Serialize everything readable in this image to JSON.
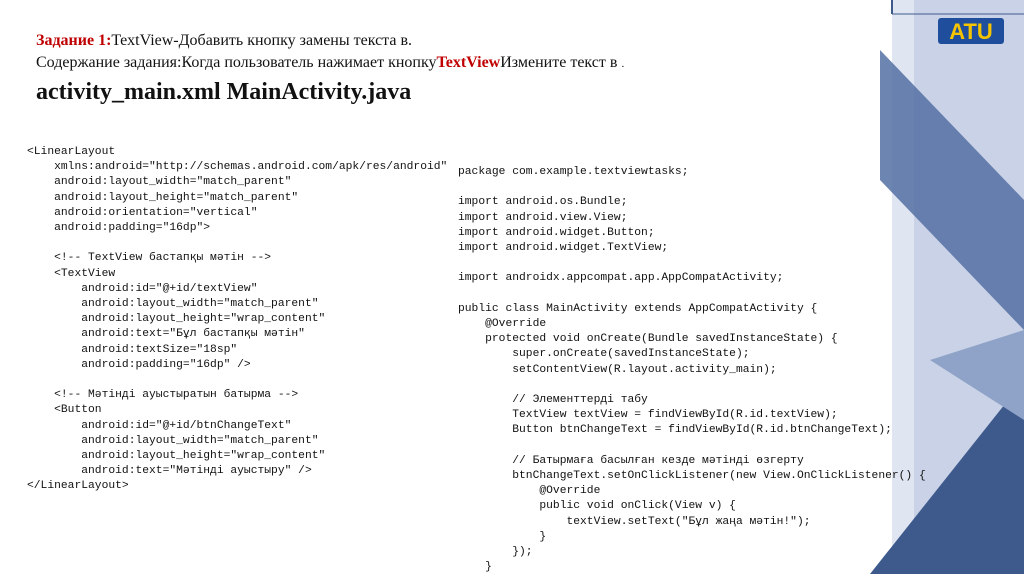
{
  "heading": {
    "task_label": "Задание 1:",
    "task_text": "TextView-Добавить кнопку замены текста в.",
    "content_label": "Содержание задания:",
    "content_text": "Когда пользователь нажимает кнопку",
    "content_highlight": "TextView",
    "content_text_end": "Измените текст в",
    "content_dot": ".",
    "files_title": "activity_main.xml MainActivity.java"
  },
  "code": {
    "xml": "<LinearLayout\n    xmlns:android=\"http://schemas.android.com/apk/res/android\"\n    android:layout_width=\"match_parent\"\n    android:layout_height=\"match_parent\"\n    android:orientation=\"vertical\"\n    android:padding=\"16dp\">\n\n    <!-- TextView бастапқы мәтін -->\n    <TextView\n        android:id=\"@+id/textView\"\n        android:layout_width=\"match_parent\"\n        android:layout_height=\"wrap_content\"\n        android:text=\"Бұл бастапқы мәтін\"\n        android:textSize=\"18sp\"\n        android:padding=\"16dp\" />\n\n    <!-- Мәтінді ауыстыратын батырма -->\n    <Button\n        android:id=\"@+id/btnChangeText\"\n        android:layout_width=\"match_parent\"\n        android:layout_height=\"wrap_content\"\n        android:text=\"Мәтінді ауыстыру\" />\n</LinearLayout>",
    "java": "package com.example.textviewtasks;\n\nimport android.os.Bundle;\nimport android.view.View;\nimport android.widget.Button;\nimport android.widget.TextView;\n\nimport androidx.appcompat.app.AppCompatActivity;\n\npublic class MainActivity extends AppCompatActivity {\n    @Override\n    protected void onCreate(Bundle savedInstanceState) {\n        super.onCreate(savedInstanceState);\n        setContentView(R.layout.activity_main);\n\n        // Элементтерді табу\n        TextView textView = findViewById(R.id.textView);\n        Button btnChangeText = findViewById(R.id.btnChangeText);\n\n        // Батырмаға басылған кезде мәтінді өзгерту\n        btnChangeText.setOnClickListener(new View.OnClickListener() {\n            @Override\n            public void onClick(View v) {\n                textView.setText(\"Бұл жаңа мәтін!\");\n            }\n        });\n    }\n}"
  },
  "logo": {
    "text": "ATU"
  },
  "colors": {
    "highlight": "#c00000",
    "logo_yellow": "#f5c400",
    "logo_blue": "#1f4e9c",
    "deco_dark": "#3e5a8c",
    "deco_light": "#c9d2e6"
  }
}
